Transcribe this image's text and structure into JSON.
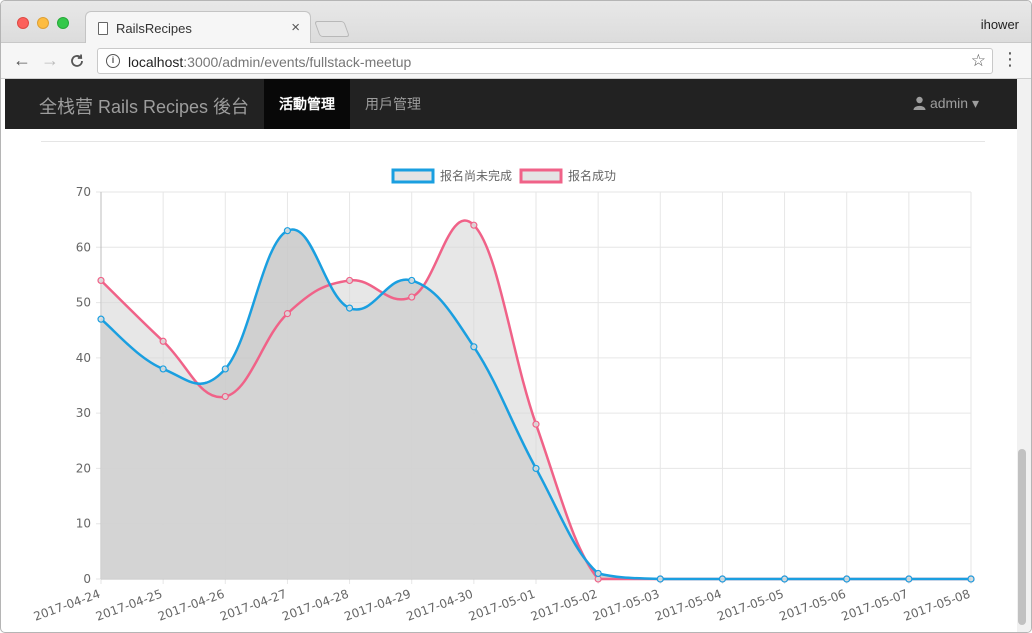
{
  "browser": {
    "tab_title": "RailsRecipes",
    "tab_close": "×",
    "profile_name": "ihower",
    "url_host": "localhost",
    "url_rest": ":3000/admin/events/fullstack-meetup",
    "back": "←",
    "forward": "→",
    "reload": "C",
    "star": "☆",
    "menu": "⋮",
    "info": "i"
  },
  "appnav": {
    "brand": "全栈营 Rails Recipes 後台",
    "items": [
      {
        "label": "活動管理",
        "active": true
      },
      {
        "label": "用戶管理",
        "active": false
      }
    ],
    "admin_label": "admin",
    "admin_caret": "▾",
    "user_icon": "user-icon"
  },
  "chart_data": {
    "type": "line",
    "categories": [
      "2017-04-24",
      "2017-04-25",
      "2017-04-26",
      "2017-04-27",
      "2017-04-28",
      "2017-04-29",
      "2017-04-30",
      "2017-05-01",
      "2017-05-02",
      "2017-05-03",
      "2017-05-04",
      "2017-05-05",
      "2017-05-06",
      "2017-05-07",
      "2017-05-08"
    ],
    "series": [
      {
        "name": "报名尚未完成",
        "color": "#1a9fe0",
        "fill": "rgba(200,200,200,0.85)",
        "values": [
          47,
          38,
          38,
          63,
          49,
          54,
          42,
          20,
          1,
          0,
          0,
          0,
          0,
          0,
          0
        ]
      },
      {
        "name": "报名成功",
        "color": "#f06288",
        "fill": "rgba(215,215,215,0.6)",
        "values": [
          54,
          43,
          33,
          48,
          54,
          51,
          64,
          28,
          0,
          0,
          0,
          0,
          0,
          0,
          0
        ]
      }
    ],
    "ylim": [
      0,
      70
    ],
    "yticks": [
      0,
      10,
      20,
      30,
      40,
      50,
      60,
      70
    ],
    "grid": true,
    "legend": "top-center"
  }
}
